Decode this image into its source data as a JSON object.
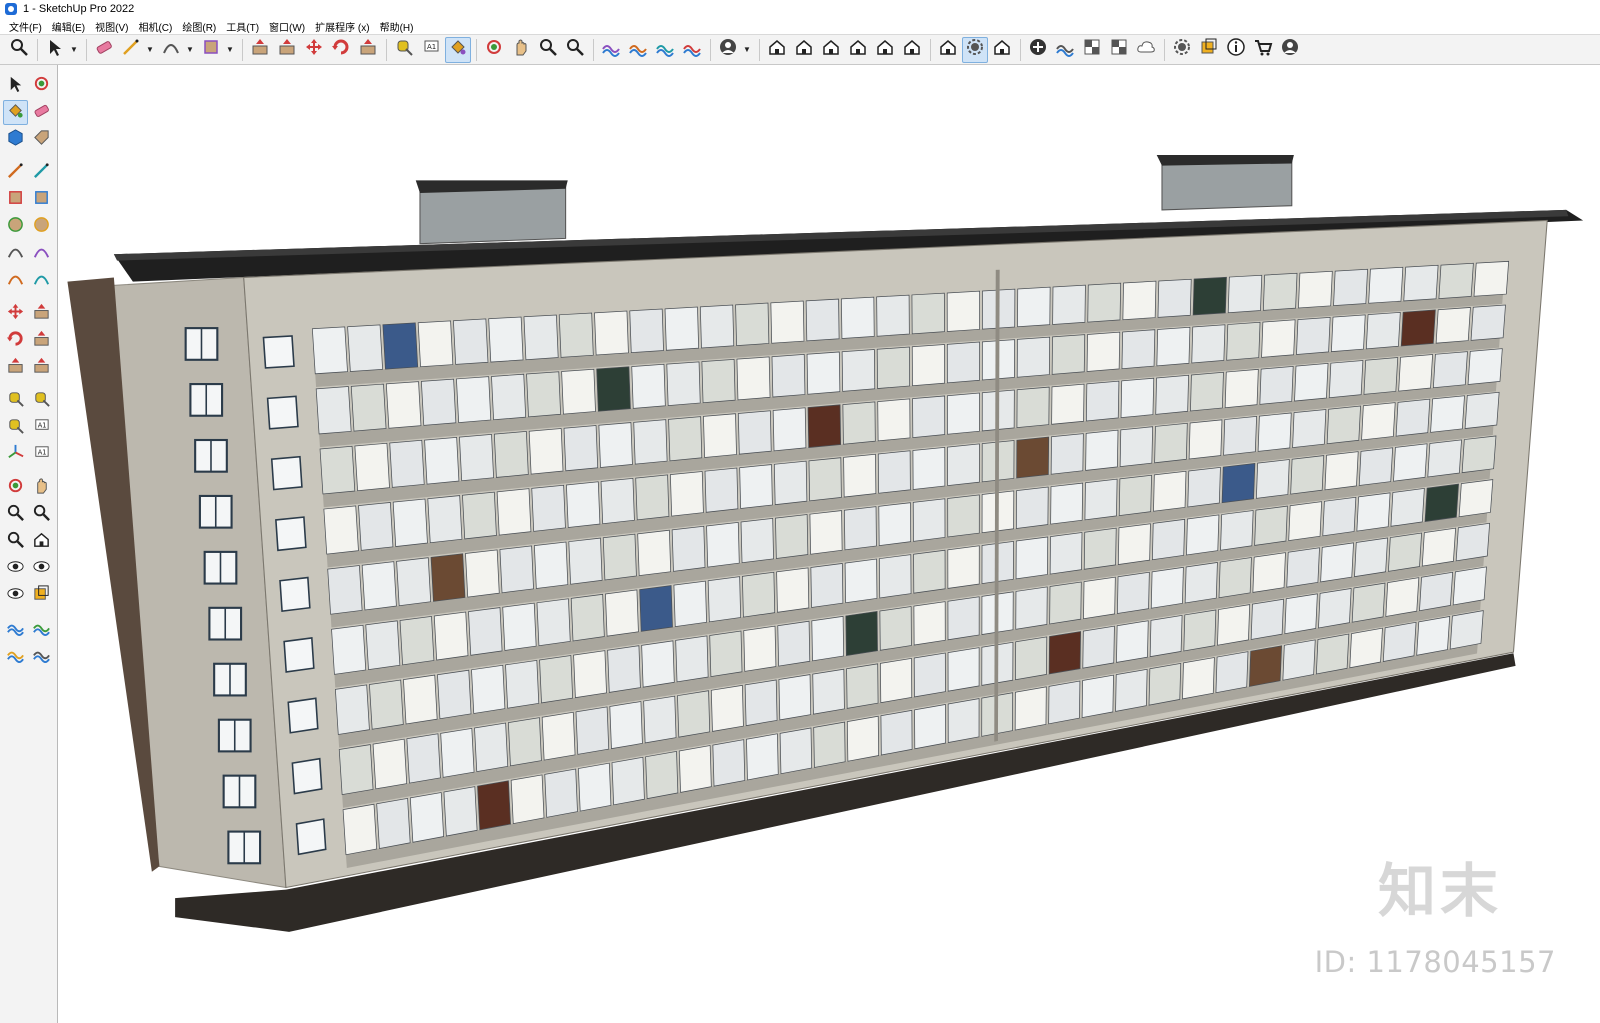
{
  "window": {
    "title": "1 - SketchUp Pro 2022"
  },
  "menu": [
    "文件(F)",
    "编辑(E)",
    "视图(V)",
    "相机(C)",
    "绘图(R)",
    "工具(T)",
    "窗口(W)",
    "扩展程序 (x)",
    "帮助(H)"
  ],
  "toolbar_icons": [
    "zoom-icon",
    "select-icon",
    "eraser-icon",
    "line-icon",
    "arc-icon",
    "rectangle-icon",
    "push-pull-icon",
    "follow-me-icon",
    "move-icon",
    "rotate-icon",
    "scale-icon",
    "tape-measure-icon",
    "text-icon",
    "paint-bucket-icon",
    "orbit-icon",
    "pan-icon",
    "zoom-tool-icon",
    "zoom-extents-icon",
    "sandbox-from-contours-icon",
    "sandbox-smoove-icon",
    "sandbox-stamp-icon",
    "sandbox-drape-icon",
    "account-icon",
    "iso-view-icon",
    "top-view-icon",
    "front-view-icon",
    "right-view-icon",
    "back-view-icon",
    "left-view-icon",
    "warehouse-icon",
    "share-model-icon",
    "extension-warehouse-icon",
    "add-location-icon",
    "solid-tools-icon",
    "styles-icon",
    "xray-icon",
    "cloud-icon",
    "extension-manager-icon",
    "section-plane-icon",
    "info-icon",
    "cart-icon",
    "profile-icon"
  ],
  "left_tools": [
    [
      "select-icon",
      "orbit-icon"
    ],
    [
      "paint-bucket-icon",
      "eraser-icon"
    ],
    [
      "component-icon",
      "tag-icon"
    ],
    [
      "line-icon",
      "freehand-icon"
    ],
    [
      "rectangle-icon",
      "rotated-rectangle-icon"
    ],
    [
      "circle-icon",
      "polygon-icon"
    ],
    [
      "arc-icon",
      "two-point-arc-icon"
    ],
    [
      "three-point-arc-icon",
      "pie-icon"
    ],
    [
      "move-icon",
      "push-pull-icon"
    ],
    [
      "rotate-icon",
      "follow-me-icon"
    ],
    [
      "scale-icon",
      "offset-icon"
    ],
    [
      "tape-measure-icon",
      "dimension-icon"
    ],
    [
      "protractor-icon",
      "text-icon"
    ],
    [
      "axes-icon",
      "3d-text-icon"
    ],
    [
      "orbit-tool-icon",
      "pan-icon"
    ],
    [
      "zoom-icon",
      "zoom-window-icon"
    ],
    [
      "zoom-extents-icon",
      "previous-view-icon"
    ],
    [
      "position-camera-icon",
      "look-around-icon"
    ],
    [
      "walk-icon",
      "section-plane-icon"
    ],
    [
      "sandbox-from-contours-icon",
      "sandbox-smoove-icon"
    ],
    [
      "sandbox-stamp-icon",
      "sandbox-drape-icon"
    ]
  ],
  "viewport": {
    "watermark_logo": "知末",
    "watermark_id": "ID: 1178045157"
  },
  "colors": {
    "toolbar_bg": "#f3f3f3",
    "active_tool": "#cfe3f7",
    "facade": "#c9c6bc",
    "roof": "#1f1f1f"
  }
}
